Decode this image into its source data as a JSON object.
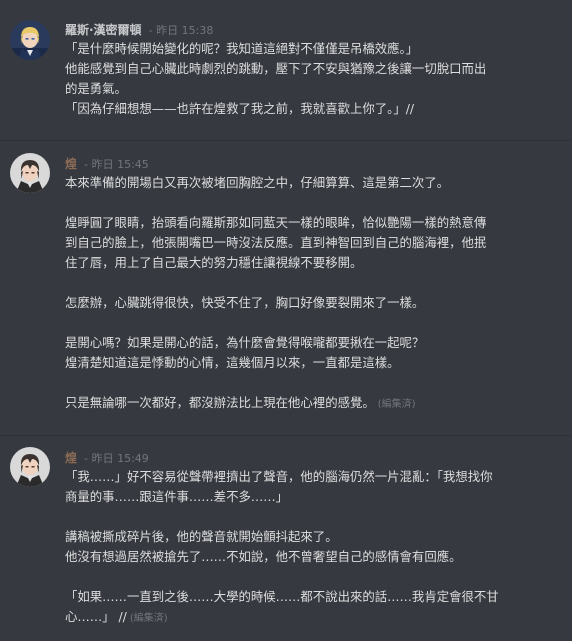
{
  "messages": [
    {
      "username": "羅斯·漢密爾頓",
      "username_color": "#c7c9cc",
      "timestamp": "昨日 15:38",
      "lines": [
        "「是什麼時候開始變化的呢？我知道這絕對不僅僅是吊橋效應。」",
        "他能感覺到自己心臟此時劇烈的跳動，壓下了不安與猶豫之後讓一切脫口而出",
        "的是勇氣。",
        "「因為仔細想想——也許在煌救了我之前，我就喜歡上你了。」//"
      ]
    },
    {
      "username": "煌",
      "username_color": "#8a6a55",
      "timestamp": "昨日 15:45",
      "lines": [
        "本來準備的開場白又再次被堵回胸腔之中，仔細算算、這是第二次了。",
        "",
        "煌睜圓了眼睛，抬頭看向羅斯那如同藍天一樣的眼眸，恰似艷陽一樣的熱意傳",
        "到自己的臉上，他張開嘴巴一時沒法反應。直到神智回到自己的腦海裡，他抿",
        "住了唇，用上了自己最大的努力穩住讓視線不要移開。",
        "",
        "怎麼辦，心臟跳得很快，快受不住了，胸口好像要裂開來了一樣。",
        "",
        "是開心嗎？如果是開心的話，為什麼會覺得喉嚨都要揪在一起呢？",
        "煌清楚知道這是悸動的心情，這幾個月以來，一直都是這樣。",
        "",
        "只是無論哪一次都好，都沒辦法比上現在他心裡的感覺。"
      ],
      "edited_label": "(編集済)"
    },
    {
      "username": "煌",
      "username_color": "#8a6a55",
      "timestamp": "昨日 15:49",
      "lines": [
        "「我……」好不容易從聲帶裡擠出了聲音，他的腦海仍然一片混亂：「我想找你",
        "商量的事……跟這件事……差不多……」",
        "",
        "講稿被撕成碎片後，他的聲音就開始顫抖起來了。",
        "他沒有想過居然被搶先了……不如說，他不曾奢望自己的感情會有回應。",
        "",
        "「如果……一直到之後……大學的時候……都不說出來的話……我肯定會很不甘",
        "心……」 //"
      ],
      "edited_label": "(編集済)"
    }
  ]
}
